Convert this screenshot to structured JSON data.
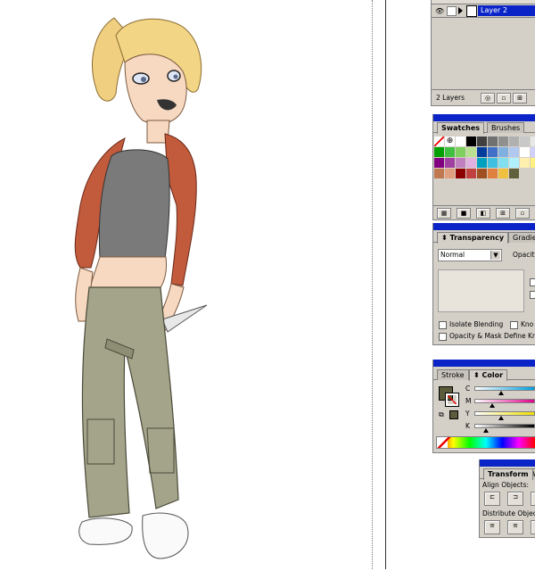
{
  "layers": {
    "layer_name": "Layer 2",
    "count_label": "2 Layers"
  },
  "swatches": {
    "tabs": [
      "Swatches",
      "Brushes"
    ],
    "colors": [
      [
        "none",
        "reg",
        "#ffffff",
        "#000000",
        "#404040",
        "#707070",
        "#909090",
        "#b0b0b0",
        "#c8c8c8",
        "#e8e8e8",
        "#ff0000"
      ],
      [
        "#00a000",
        "#40c040",
        "#80d060",
        "#b8e090",
        "#003c9c",
        "#4070c8",
        "#80b0e0",
        "#b0c8f0",
        "#ffffff",
        "#d0d0ff",
        "#ff8000"
      ],
      [
        "#800080",
        "#a040a0",
        "#c080c0",
        "#e0b0e0",
        "#00a0c0",
        "#40c0e0",
        "#80e0f0",
        "#b0f0ff",
        "#fff0b0",
        "#fff080",
        "#ffff00"
      ],
      [
        "#c07850",
        "#e0a080",
        "#8c0000",
        "#c04040",
        "#a05020",
        "#e08040",
        "#f0c040",
        "#60603c",
        "",
        "",
        ""
      ]
    ]
  },
  "transparency": {
    "tabs": [
      "Transparency",
      "Gradient"
    ],
    "blend_mode": "Normal",
    "opacity_label": "Opacity",
    "isolate_label": "Isolate Blending",
    "knockout_label": "Kno",
    "mask_label": "Opacity & Mask Define Kn"
  },
  "color": {
    "tabs": [
      "Stroke",
      "Color"
    ],
    "channels": [
      {
        "label": "C",
        "value": 0.45,
        "gradient": "linear-gradient(90deg,#fff,#00a0e0)"
      },
      {
        "label": "M",
        "value": 0.3,
        "gradient": "linear-gradient(90deg,#fff,#e0008c)"
      },
      {
        "label": "Y",
        "value": 0.45,
        "gradient": "linear-gradient(90deg,#fff,#f0e000)"
      },
      {
        "label": "K",
        "value": 0.2,
        "gradient": "linear-gradient(90deg,#fff,#000)"
      }
    ],
    "fill_color": "#5c5c3c"
  },
  "align": {
    "tabs": [
      "Transform",
      "A"
    ],
    "align_objects_label": "Align Objects:",
    "distribute_label": "Distribute Object"
  }
}
